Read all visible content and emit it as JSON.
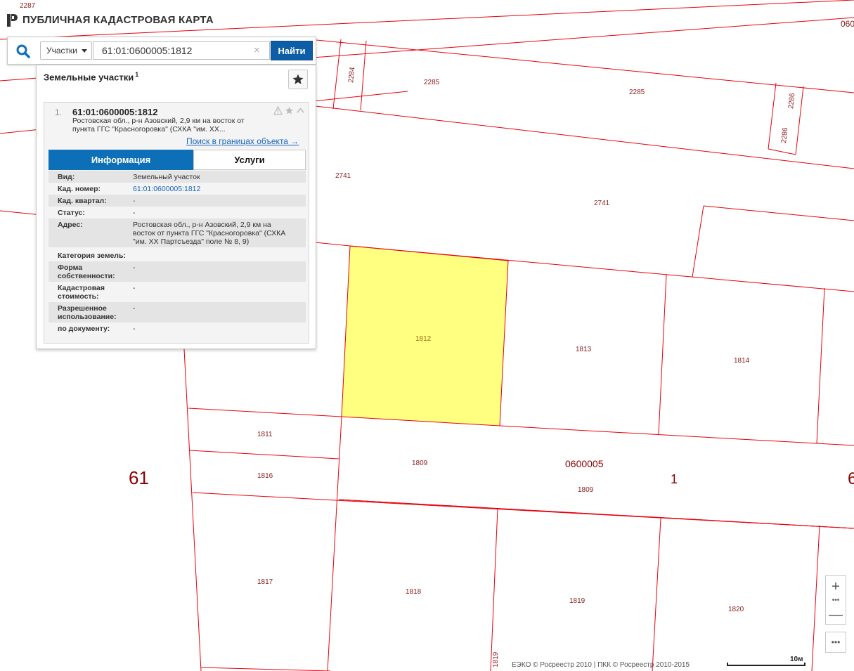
{
  "app": {
    "title": "ПУБЛИЧНАЯ КАДАСТРОВАЯ КАРТА"
  },
  "search": {
    "type_label": "Участки",
    "query": "61:01:0600005:1812",
    "clear_symbol": "×",
    "submit_label": "Найти"
  },
  "results": {
    "title": "Земельные участки",
    "count": "1",
    "item": {
      "index": "1.",
      "number": "61:01:0600005:1812",
      "address_short": "Ростовская обл., р-н Азовский, 2,9 км на восток от пункта ГГС \"Красногоровка\" (СХКА \"им. XX...",
      "search_in_bounds": "Поиск в границах объекта →",
      "tabs": {
        "info": "Информация",
        "services": "Услуги"
      },
      "rows": [
        {
          "key": "Вид:",
          "value": "Земельный участок"
        },
        {
          "key": "Кад. номер:",
          "value": "61:01:0600005:1812"
        },
        {
          "key": "Кад. квартал:",
          "value": "-"
        },
        {
          "key": "Статус:",
          "value": "-"
        },
        {
          "key": "Адрес:",
          "value": "Ростовская обл., р-н Азовский, 2,9 км на восток от пункта ГГС \"Красногоровка\" (СХКА \"им. XX Партсъезда\" поле № 8, 9)"
        },
        {
          "key": "Категория земель:",
          "value": ""
        },
        {
          "key": "Форма собственности:",
          "value": "-"
        },
        {
          "key": "Кадастровая стоимость:",
          "value": "-"
        },
        {
          "key": "Разрешенное использование:",
          "value": "-"
        },
        {
          "key": "по документу:",
          "value": "-"
        }
      ]
    }
  },
  "map": {
    "plot_labels": [
      "2287",
      "060",
      "2284",
      "2285",
      "2285",
      "2286",
      "2286",
      "2741",
      "2741",
      "1812",
      "1813",
      "1814",
      "1811",
      "1809",
      "1816",
      "1809",
      "1817",
      "1818",
      "1819",
      "1819",
      "1820"
    ],
    "region_label": "61",
    "district_label": "1",
    "district_label_right": "6",
    "quarter_label": "0600005",
    "colors": {
      "boundary": "#e8000d",
      "selected_fill": "#ffff80",
      "label": "#8b1a1a"
    }
  },
  "controls": {
    "zoom_in": "+",
    "zoom_dots": "•••",
    "zoom_out": "—",
    "more": "•••",
    "attribution": "ЕЭКО © Росреестр 2010 | ПКК © Росреестр 2010-2015",
    "scale": "10м"
  }
}
